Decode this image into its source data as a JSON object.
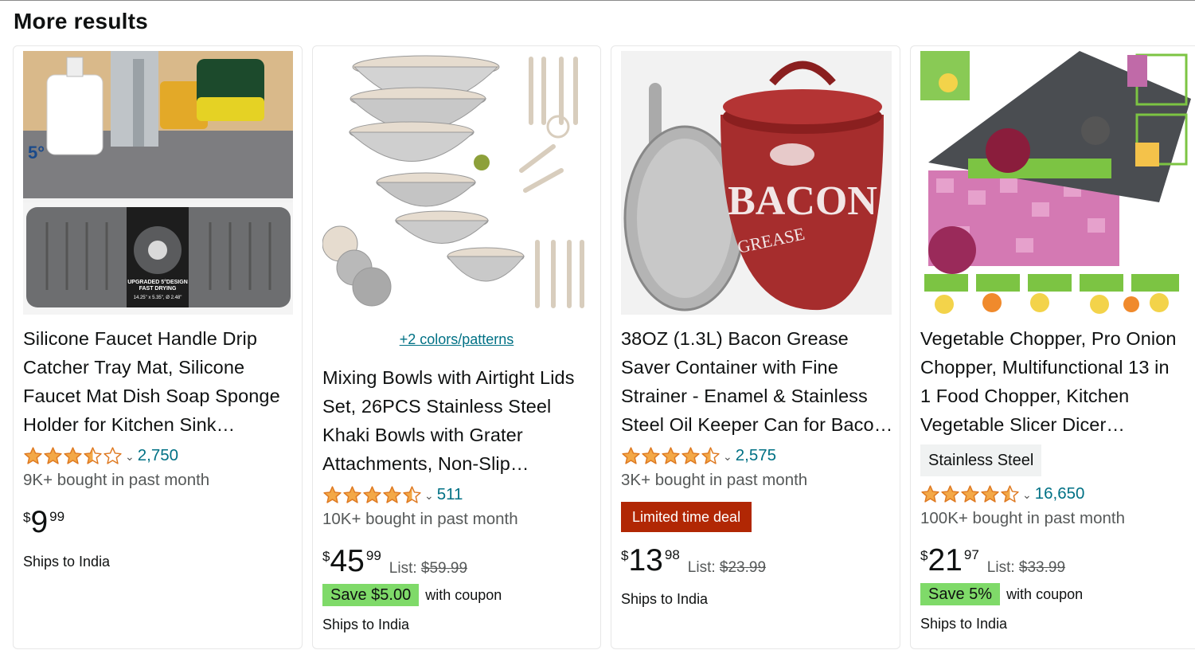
{
  "heading": "More results",
  "colors": {
    "star": "#f3a847",
    "link": "#007185",
    "deal_bg": "#b12704",
    "coupon_bg": "#7fda69"
  },
  "products": [
    {
      "title_lines": [
        "Silicone Faucet Handle Drip",
        "Catcher Tray Mat, Silicone",
        "Faucet Mat Dish Soap Sponge",
        "Holder for Kitchen Sink…"
      ],
      "rating": 3.5,
      "rating_count": "2,750",
      "bought": "9K+ bought in past month",
      "price": {
        "symbol": "$",
        "whole": "9",
        "fraction": "99"
      },
      "ships": "Ships to India",
      "image_text": {
        "angle": "5°",
        "tag_line1": "UPGRADED 5°DESIGN",
        "tag_line2": "FAST DRYING",
        "dims": "14.25\" x 5.35\", Ø 2.48\""
      }
    },
    {
      "colors_link": "+2 colors/patterns",
      "title_lines": [
        "Mixing Bowls with Airtight Lids",
        "Set, 26PCS Stainless Steel",
        "Khaki Bowls with Grater",
        "Attachments, Non-Slip…"
      ],
      "rating": 4.5,
      "rating_count": "511",
      "bought": "10K+ bought in past month",
      "price": {
        "symbol": "$",
        "whole": "45",
        "fraction": "99",
        "list_label": "List:",
        "list_price": "$59.99"
      },
      "coupon": {
        "save": "Save $5.00",
        "with": "with coupon"
      },
      "ships": "Ships to India"
    },
    {
      "title_lines": [
        "38OZ (1.3L) Bacon Grease",
        "Saver Container with Fine",
        "Strainer - Enamel & Stainless",
        "Steel Oil Keeper Can for Baco…"
      ],
      "rating": 4.5,
      "rating_count": "2,575",
      "bought": "3K+ bought in past month",
      "deal": "Limited time deal",
      "price": {
        "symbol": "$",
        "whole": "13",
        "fraction": "98",
        "list_label": "List:",
        "list_price": "$23.99"
      },
      "ships": "Ships to India",
      "image_text": {
        "word1": "BACON",
        "word2": "GREASE"
      }
    },
    {
      "title_lines": [
        "Vegetable Chopper, Pro Onion",
        "Chopper, Multifunctional 13 in",
        "1 Food Chopper, Kitchen",
        "Vegetable Slicer Dicer…"
      ],
      "variant": "Stainless Steel",
      "rating": 4.5,
      "rating_count": "16,650",
      "bought": "100K+ bought in past month",
      "price": {
        "symbol": "$",
        "whole": "21",
        "fraction": "97",
        "list_label": "List:",
        "list_price": "$33.99"
      },
      "coupon": {
        "save": "Save 5%",
        "with": "with coupon"
      },
      "ships": "Ships to India"
    }
  ]
}
